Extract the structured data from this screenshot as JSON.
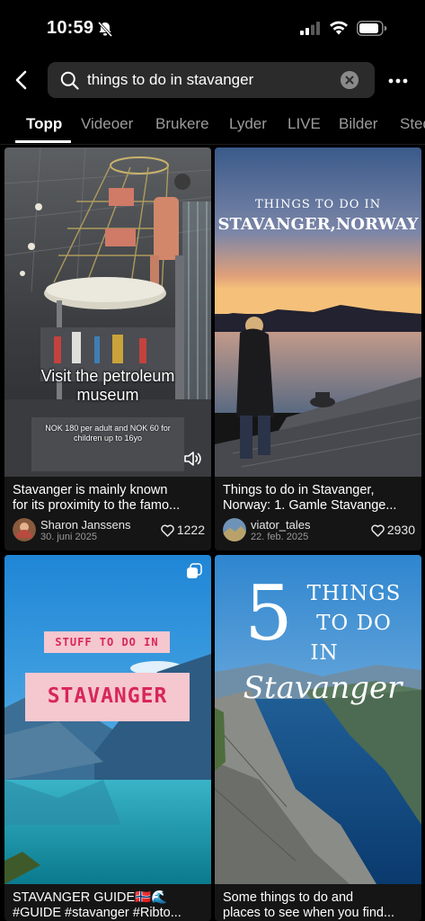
{
  "status_bar": {
    "time": "10:59"
  },
  "search": {
    "query": "things to do in stavanger"
  },
  "tabs": [
    {
      "label": "Topp"
    },
    {
      "label": "Videoer"
    },
    {
      "label": "Brukere"
    },
    {
      "label": "Lyder"
    },
    {
      "label": "LIVE"
    },
    {
      "label": "Bilder"
    },
    {
      "label": "Steder"
    }
  ],
  "results": [
    {
      "overlay_title": "Visit the petroleum museum",
      "overlay_sub": "NOK 180 per adult and NOK 60 for children up to 16yo",
      "caption_line1": "Stavanger is mainly known",
      "caption_line2": "for its proximity to the famo...",
      "author": "Sharon Janssens",
      "date": "30. juni 2025",
      "likes": "1222",
      "icon": "speaker-icon"
    },
    {
      "overlay_line1": "THINGS TO DO IN",
      "overlay_line2": "STAVANGER,NORWAY",
      "caption_line1": "Things to do in Stavanger,",
      "caption_line2": "Norway: 1.  Gamle Stavange...",
      "author": "viator_tales",
      "date": "22. feb. 2025",
      "likes": "2930"
    },
    {
      "overlay_line1": "STUFF TO DO IN",
      "overlay_line2": "STAVANGER",
      "caption_line1": "STAVANGER GUIDE🇳🇴🌊",
      "caption_line2": "#GUIDE #stavanger #Ribto...",
      "icon": "photo-carousel-icon"
    },
    {
      "overlay_number": "5",
      "overlay_line1": "THINGS",
      "overlay_line2": "TO DO",
      "overlay_line3": "IN",
      "overlay_script": "Stavanger",
      "caption_line1": "Some things to do and",
      "caption_line2": "places to see when you find..."
    }
  ],
  "colors": {
    "background": "#000000",
    "search_box": "#2b2b2b",
    "pink_label": "#f5c7cf",
    "pink_text": "#d8265a"
  }
}
